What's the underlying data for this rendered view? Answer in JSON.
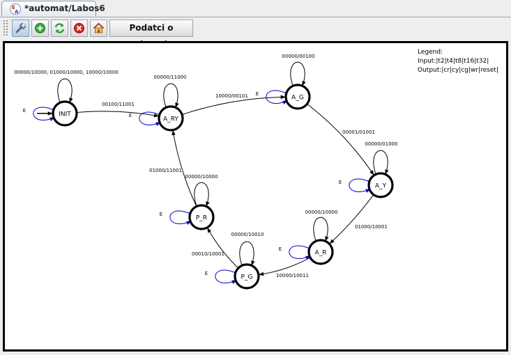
{
  "tab": {
    "title": "*automat/Labos6"
  },
  "toolbar": {
    "info_button_label": "Podatci o automatu"
  },
  "legend": {
    "title": "Legend:",
    "input": "Input:|t2|t4|t8|t16|t32|",
    "output": "Output:|cr|cy|cg|wr|reset|"
  },
  "states": [
    "INIT",
    "A_RY",
    "A_G",
    "A_Y",
    "A_R",
    "P_G",
    "P_R"
  ],
  "initial_state": "INIT",
  "loop_label": "E",
  "self_loops": [
    {
      "state": "INIT",
      "label": "00000/10000, 01000/10000, 10000/10000"
    },
    {
      "state": "A_RY",
      "label": "00000/11000"
    },
    {
      "state": "A_G",
      "label": "00000/00100"
    },
    {
      "state": "A_Y",
      "label": "00000/01000"
    },
    {
      "state": "A_R",
      "label": "00000/10000"
    },
    {
      "state": "P_G",
      "label": "00000/10010"
    },
    {
      "state": "P_R",
      "label": "00000/10000"
    }
  ],
  "transitions": [
    {
      "from": "INIT",
      "to": "A_RY",
      "label": "00100/11001"
    },
    {
      "from": "A_RY",
      "to": "A_G",
      "label": "10000/00101"
    },
    {
      "from": "A_G",
      "to": "A_Y",
      "label": "00001/01001"
    },
    {
      "from": "A_Y",
      "to": "A_R",
      "label": "01000/10001"
    },
    {
      "from": "A_R",
      "to": "P_G",
      "label": "10000/10011"
    },
    {
      "from": "P_G",
      "to": "P_R",
      "label": "00010/10001"
    },
    {
      "from": "P_R",
      "to": "A_RY",
      "label": "01000/11001"
    }
  ],
  "colors": {
    "e_loop": "#0000cc",
    "edge": "#000000",
    "canvas_bg": "#ffffff"
  }
}
